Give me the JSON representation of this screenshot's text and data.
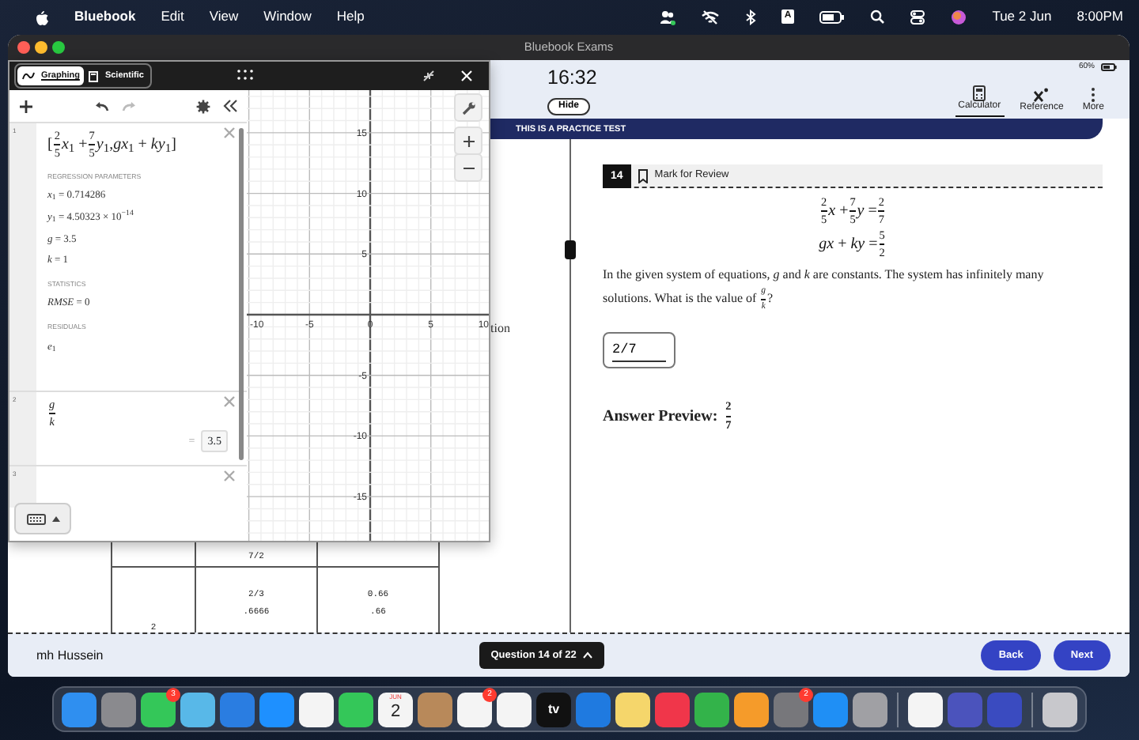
{
  "menu_bar": {
    "app": "Bluebook",
    "items": [
      "Edit",
      "View",
      "Window",
      "Help"
    ],
    "input_source": "A",
    "date": "Tue 2 Jun",
    "time": "8:00PM"
  },
  "window": {
    "title": "Bluebook Exams"
  },
  "header": {
    "timer": "16:32",
    "hide_label": "Hide",
    "battery": "60%",
    "tools": [
      {
        "kind": "calculator",
        "label": "Calculator",
        "selected": true
      },
      {
        "kind": "reference",
        "label": "Reference",
        "selected": false
      },
      {
        "kind": "more",
        "label": "More",
        "selected": false
      }
    ]
  },
  "banner": "THIS IS A PRACTICE TEST",
  "calculator": {
    "tabs": [
      {
        "kind": "graphing",
        "label": "Graphing",
        "selected": true
      },
      {
        "kind": "scientific",
        "label": "Scientific",
        "selected": false
      }
    ],
    "expressions": [
      {
        "number": "1",
        "kind": "regression",
        "formula": [
          "[",
          {
            "num": "2",
            "den": "5"
          },
          "*x*$_{1}$ + ",
          {
            "num": "7",
            "den": "5"
          },
          "*y*$_{1}$,*gx*$_{1}$ + *ky*$_{1}$",
          "]"
        ],
        "sections": [
          {
            "heading": "REGRESSION PARAMETERS",
            "lines": [
              "*x*$_{1}$ = 0.714286",
              "*y*$_{1}$ = 4.50323 × 10$^{−14}$",
              "*g* = 3.5",
              "*k* = 1"
            ]
          },
          {
            "heading": "STATISTICS",
            "lines": [
              "*RMSE* = 0"
            ]
          },
          {
            "heading": "RESIDUALS",
            "lines": [
              "*e*$_{1}$"
            ]
          }
        ]
      },
      {
        "number": "2",
        "kind": "value",
        "formula": [
          {
            "num": "*g*",
            "den": "*k*"
          }
        ],
        "result_sign": "=",
        "result": "3.5"
      },
      {
        "number": "3",
        "kind": "empty"
      }
    ],
    "graph": {
      "x_labels": [
        "-10",
        "-5",
        "0",
        "5",
        "10"
      ],
      "y_labels": [
        "15",
        "10",
        "5",
        "-5",
        "-10",
        "-15"
      ]
    }
  },
  "left_pane": {
    "partial_text": "tion",
    "table_rows": [
      [
        [],
        [
          "7/2"
        ],
        []
      ],
      [
        [
          "2"
        ],
        [
          "2/3",
          ".6666"
        ],
        [
          "0.66",
          ".66"
        ]
      ]
    ]
  },
  "question": {
    "number": "14",
    "mark_label": "Mark for Review",
    "marked": false,
    "equations": [
      [
        {
          "num": "2",
          "den": "5"
        },
        "*x* + ",
        {
          "num": "7",
          "den": "5"
        },
        "*y* = ",
        {
          "num": "2",
          "den": "7"
        }
      ],
      [
        "*gx* + *ky* = ",
        {
          "num": "5",
          "den": "2"
        }
      ]
    ],
    "prompt": [
      "In the given system of equations, *g* and *k* are constants. The system has infinitely many solutions. What is the value of ",
      {
        "num": "*g*",
        "den": "*k*"
      },
      "?"
    ],
    "answer": "2/7",
    "preview_label": "Answer Preview:",
    "preview": [
      {
        "num": "2",
        "den": "7"
      }
    ]
  },
  "footer": {
    "student": "mh Hussein",
    "progress": "Question 14 of 22",
    "back": "Back",
    "next": "Next"
  },
  "dock": [
    {
      "kind": "app",
      "color": "#2f8ff0"
    },
    {
      "kind": "app",
      "color": "#8a8a8e"
    },
    {
      "kind": "app",
      "color": "#34c759",
      "badge": "3"
    },
    {
      "kind": "app",
      "color": "#58b8e8"
    },
    {
      "kind": "app",
      "color": "#2a7de1"
    },
    {
      "kind": "app",
      "color": "#1e90ff"
    },
    {
      "kind": "app",
      "color": "#f4f4f4"
    },
    {
      "kind": "app",
      "color": "#34c759"
    },
    {
      "kind": "calendar",
      "color": "#f4f4f4",
      "month": "JUN",
      "day": "2"
    },
    {
      "kind": "app",
      "color": "#b8895a"
    },
    {
      "kind": "app",
      "color": "#f4f4f4",
      "badge": "2"
    },
    {
      "kind": "app",
      "color": "#f4f4f4"
    },
    {
      "kind": "tv",
      "color": "#111111",
      "label": "tv"
    },
    {
      "kind": "app",
      "color": "#1f7ae0"
    },
    {
      "kind": "app",
      "color": "#f5d66b"
    },
    {
      "kind": "app",
      "color": "#f0364a"
    },
    {
      "kind": "app",
      "color": "#33b34a"
    },
    {
      "kind": "app",
      "color": "#f59b2a"
    },
    {
      "kind": "app",
      "color": "#77777b",
      "badge": "2"
    },
    {
      "kind": "app",
      "color": "#1f8ff5"
    },
    {
      "kind": "app",
      "color": "#a0a0a4"
    },
    {
      "kind": "separator"
    },
    {
      "kind": "app",
      "color": "#f4f4f4"
    },
    {
      "kind": "app",
      "color": "#4b53bc"
    },
    {
      "kind": "app",
      "color": "#3a4bc0"
    },
    {
      "kind": "separator"
    },
    {
      "kind": "app",
      "color": "#c8c8cc"
    }
  ]
}
